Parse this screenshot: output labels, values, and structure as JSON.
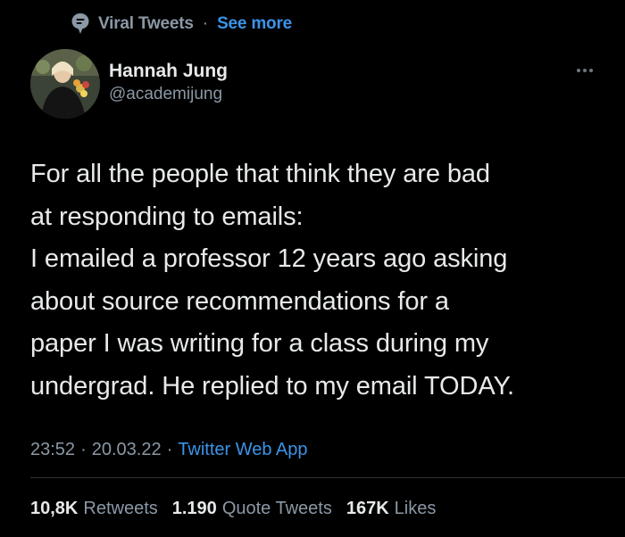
{
  "social_context": {
    "icon": "topic-bubble-icon",
    "label": "Viral Tweets",
    "separator": "·",
    "link": "See more"
  },
  "author": {
    "display_name": "Hannah Jung",
    "handle": "@academijung",
    "avatar": "avatar-photo"
  },
  "tweet": {
    "lines": [
      "For all the people that think they are bad",
      "at responding to emails:",
      "I emailed a professor 12 years ago asking",
      "about source recommendations for a",
      "paper I was writing for a class during my",
      "undergrad. He replied to my email TODAY."
    ]
  },
  "meta": {
    "time": "23:52",
    "sep1": "·",
    "date": "20.03.22",
    "sep2": "·",
    "source": "Twitter Web App"
  },
  "stats": {
    "retweets_count": "10,8K",
    "retweets_label": "Retweets",
    "quotes_count": "1.190",
    "quotes_label": "Quote Tweets",
    "likes_count": "167K",
    "likes_label": "Likes"
  },
  "colors": {
    "background": "#000000",
    "text_primary": "#e7e9ea",
    "text_secondary": "#8b98a5",
    "link": "#3c94e8"
  }
}
